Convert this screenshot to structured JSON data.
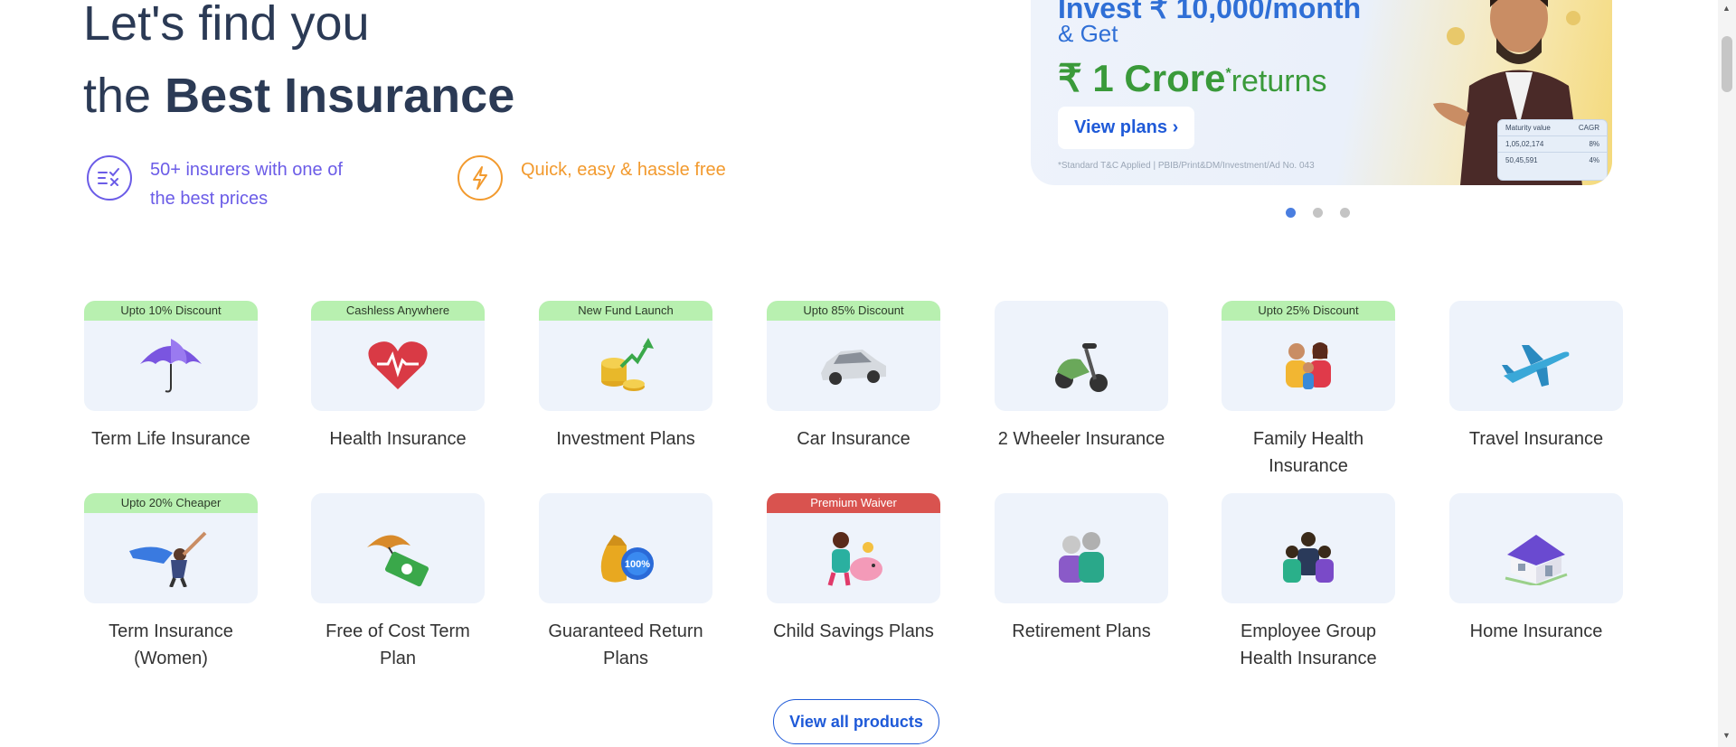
{
  "hero": {
    "line1": "Let's find you",
    "line2_pre": "the ",
    "line2_bold": "Best Insurance"
  },
  "features": [
    {
      "text": "50+ insurers with one of the best prices",
      "color": "#6b5ce7",
      "icon": "compare-checklist-icon"
    },
    {
      "text": "Quick, easy & hassle free",
      "color": "#f29a2e",
      "icon": "lightning-icon"
    }
  ],
  "banner": {
    "line1": "Invest ₹ 10,000/month",
    "line2": "& Get",
    "amount": "₹ 1 Crore",
    "star": "*",
    "returns": "returns",
    "button": "View plans",
    "disclaimer": "*Standard T&C Applied | PBIB/Print&DM/Investment/Ad No. 043",
    "table": {
      "headers": [
        "Maturity value",
        "CAGR"
      ],
      "rows": [
        [
          "1,05,02,174",
          "8%"
        ],
        [
          "50,45,591",
          "4%"
        ]
      ]
    }
  },
  "carousel": {
    "count": 3,
    "active": 0
  },
  "products": [
    {
      "label": "Term Life Insurance",
      "badge": "Upto 10% Discount",
      "icon": "umbrella-icon"
    },
    {
      "label": "Health Insurance",
      "badge": "Cashless Anywhere",
      "icon": "heart-pulse-icon"
    },
    {
      "label": "Investment Plans",
      "badge": "New Fund Launch",
      "icon": "coins-growth-icon"
    },
    {
      "label": "Car Insurance",
      "badge": "Upto 85% Discount",
      "icon": "car-icon"
    },
    {
      "label": "2 Wheeler Insurance",
      "badge": "",
      "icon": "scooter-icon"
    },
    {
      "label": "Family Health Insurance",
      "badge": "Upto 25% Discount",
      "icon": "family-icon"
    },
    {
      "label": "Travel Insurance",
      "badge": "",
      "icon": "airplane-icon"
    },
    {
      "label": "Term Insurance (Women)",
      "badge": "Upto 20% Cheaper",
      "icon": "superwoman-icon"
    },
    {
      "label": "Free of Cost Term Plan",
      "badge": "",
      "icon": "umbrella-cash-icon"
    },
    {
      "label": "Guaranteed Return Plans",
      "badge": "",
      "icon": "money-bag-100-icon"
    },
    {
      "label": "Child Savings Plans",
      "badge": "Premium Waiver",
      "badge_style": "red",
      "icon": "child-piggybank-icon"
    },
    {
      "label": "Retirement Plans",
      "badge": "",
      "icon": "elderly-couple-icon"
    },
    {
      "label": "Employee Group Health Insurance",
      "badge": "",
      "icon": "employee-group-icon"
    },
    {
      "label": "Home Insurance",
      "badge": "",
      "icon": "house-icon"
    }
  ],
  "view_all": "View all products"
}
